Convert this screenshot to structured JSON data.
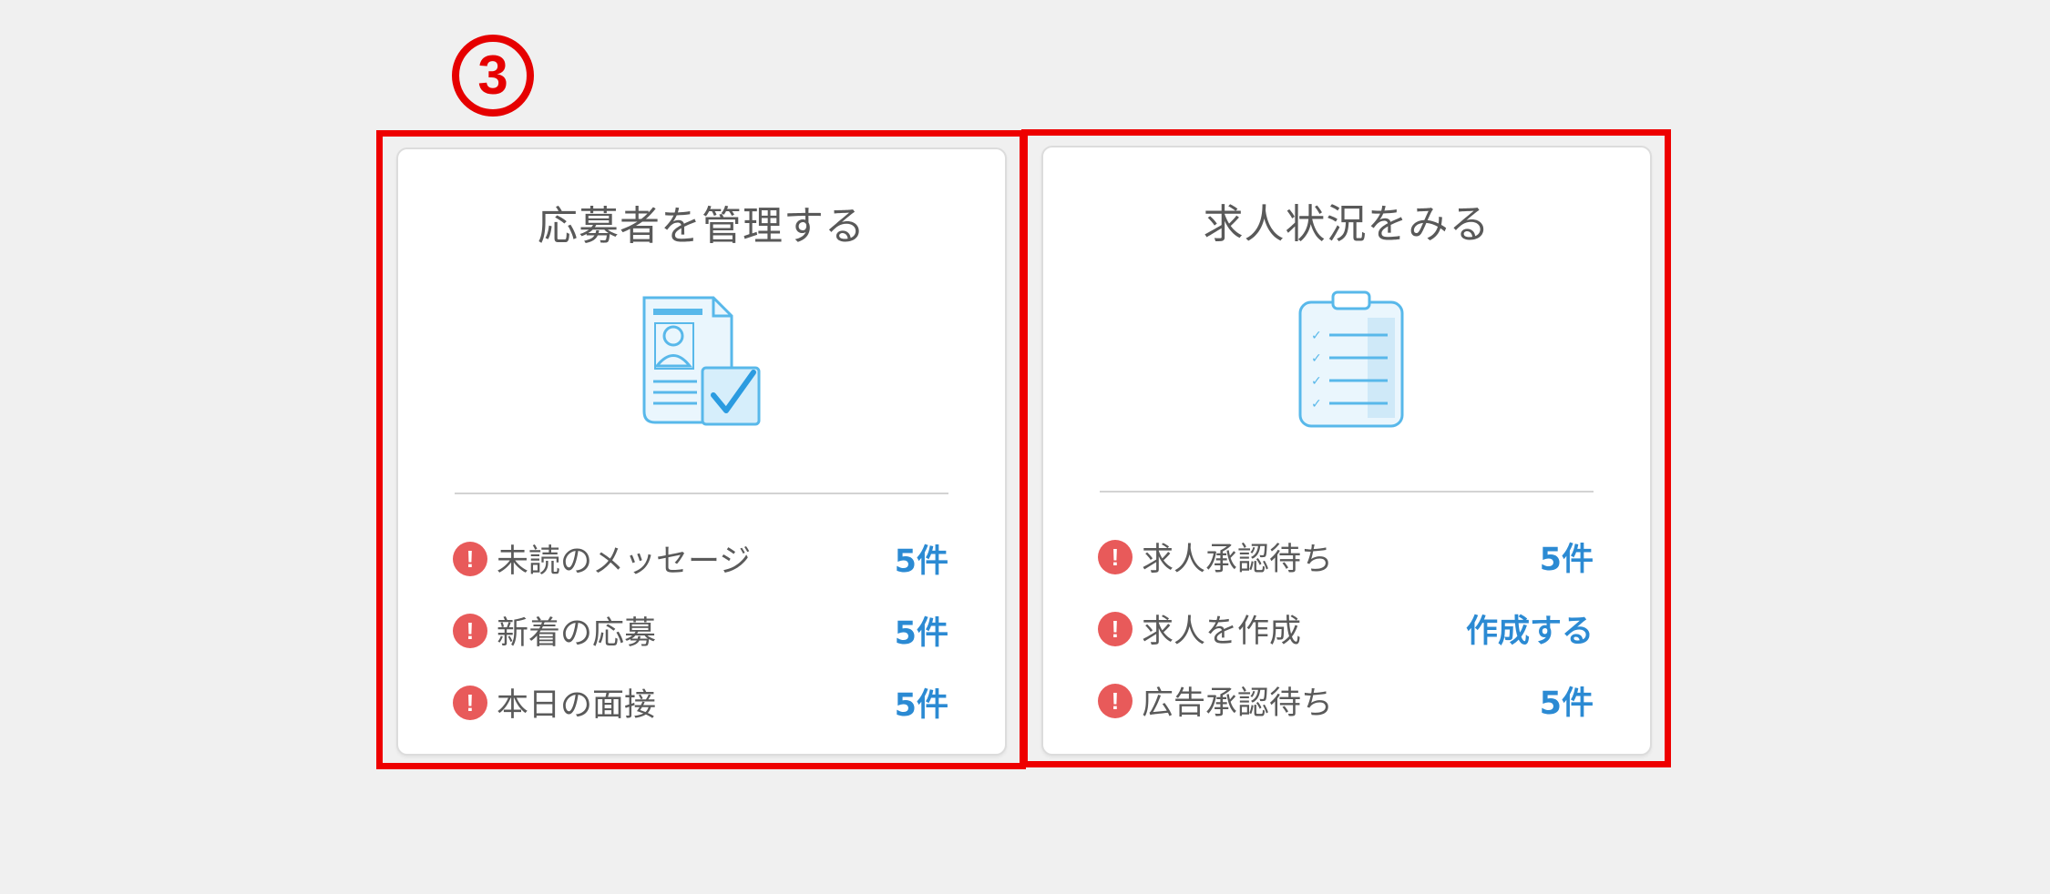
{
  "annotation": {
    "step_marker": "③",
    "highlight_color": "#ee0000"
  },
  "colors": {
    "accent_blue": "#2b8ad3",
    "alert_red": "#e85a5a",
    "icon_blue": "#58b8ea"
  },
  "cards": [
    {
      "title": "応募者を管理する",
      "icon": "applicant-document-check-icon",
      "rows": [
        {
          "label": "未読のメッセージ",
          "value": "5件"
        },
        {
          "label": "新着の応募",
          "value": "5件"
        },
        {
          "label": "本日の面接",
          "value": "5件"
        }
      ]
    },
    {
      "title": "求人状況をみる",
      "icon": "clipboard-checklist-icon",
      "rows": [
        {
          "label": "求人承認待ち",
          "value": "5件"
        },
        {
          "label": "求人を作成",
          "value": "作成する"
        },
        {
          "label": "広告承認待ち",
          "value": "5件"
        }
      ]
    }
  ],
  "alert_glyph": "!"
}
